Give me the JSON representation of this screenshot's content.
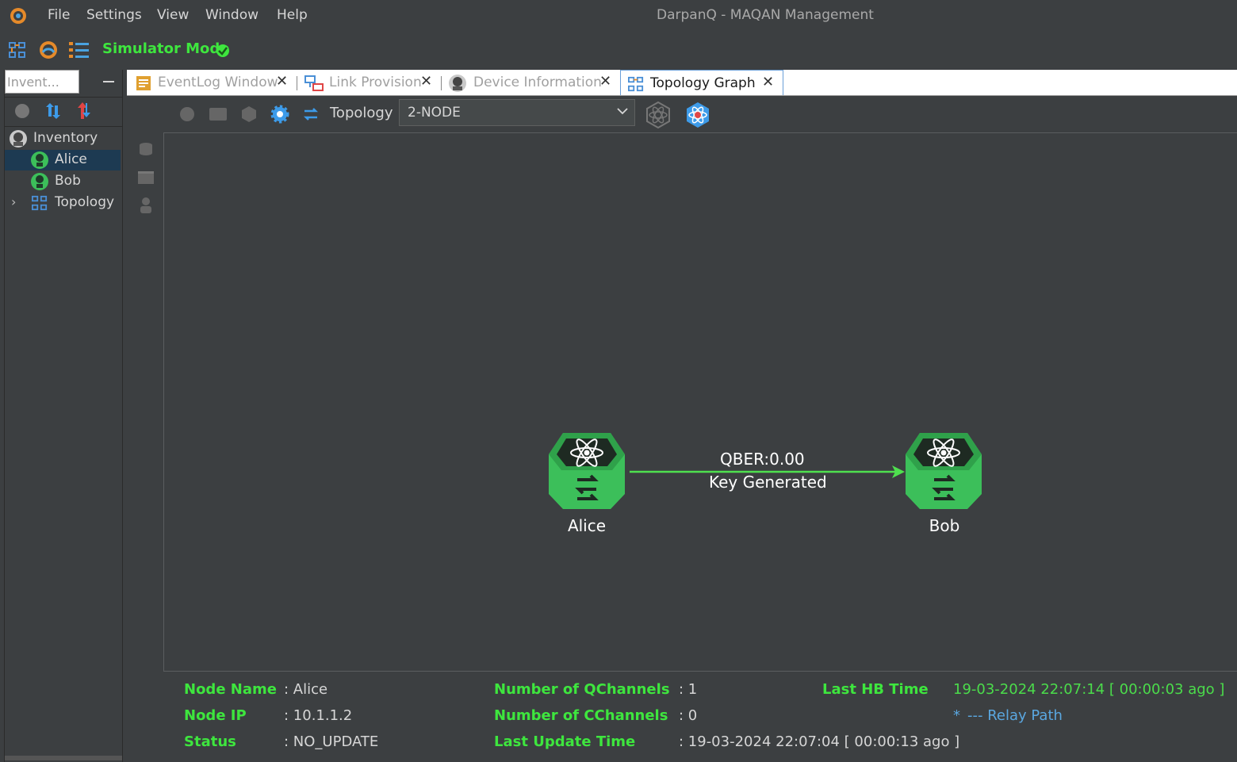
{
  "app": {
    "title": "DarpanQ - MAQAN Management"
  },
  "menu": {
    "items": [
      "File",
      "Settings",
      "View",
      "Window",
      "Help"
    ]
  },
  "toolbar": {
    "mode_label": "Simulator Mode"
  },
  "left_panel": {
    "search_value": "Invent...",
    "tree": {
      "root": "Inventory",
      "items": [
        "Alice",
        "Bob",
        "Topology"
      ],
      "selected": "Alice"
    }
  },
  "tabs": [
    {
      "label": "EventLog Window",
      "icon": "eventlog-icon",
      "active": false
    },
    {
      "label": "Link Provision",
      "icon": "link-provision-icon",
      "active": false
    },
    {
      "label": "Device Information",
      "icon": "device-info-icon",
      "active": false
    },
    {
      "label": "Topology Graph",
      "icon": "topology-icon",
      "active": true
    }
  ],
  "graph_toolbar": {
    "topology_label": "Topology",
    "topology_value": "2-NODE"
  },
  "graph": {
    "nodes": [
      {
        "name": "Alice"
      },
      {
        "name": "Bob"
      }
    ],
    "link": {
      "qber": "QBER:0.00",
      "status": "Key Generated",
      "color": "#4fe04f"
    }
  },
  "info": {
    "node_name_key": "Node Name",
    "node_name_val": ": Alice",
    "node_ip_key": "Node IP",
    "node_ip_val": ": 10.1.1.2",
    "status_key": "Status",
    "status_val": ": NO_UPDATE",
    "qchannels_key": "Number of QChannels",
    "qchannels_val": ": 1",
    "cchannels_key": "Number of CChannels",
    "cchannels_val": ": 0",
    "last_update_key": "Last Update Time",
    "last_update_val": ": 19-03-2024 22:07:04 [ 00:00:13 ago ]",
    "last_hb_key": "Last HB Time",
    "last_hb_val": "19-03-2024 22:07:14 [ 00:00:03 ago ]",
    "relay_path_marker": "*",
    "relay_path_label": "--- Relay Path"
  },
  "colors": {
    "accent_green": "#3ee63e",
    "relay_blue": "#5aa7e0",
    "node_green": "#3cbf5a"
  }
}
